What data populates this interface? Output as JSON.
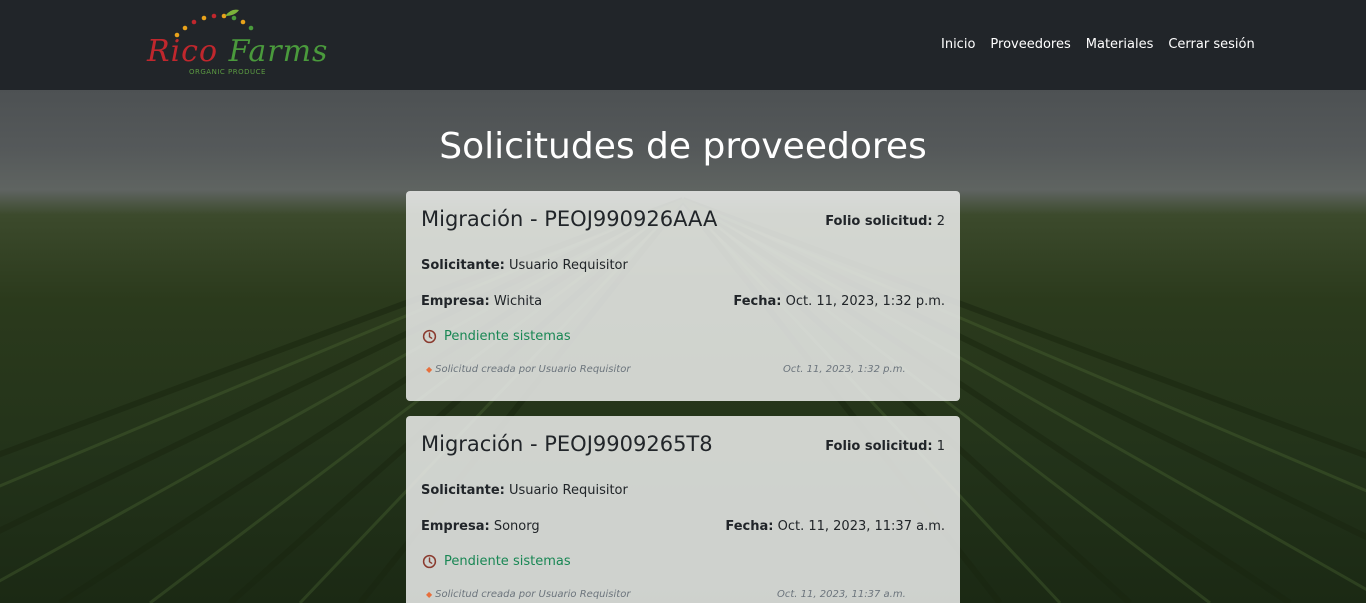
{
  "brand": {
    "name_part1": "Rico",
    "name_part2": "Farms",
    "tagline": "ORGANIC PRODUCE"
  },
  "nav": {
    "items": [
      {
        "label": "Inicio"
      },
      {
        "label": "Proveedores"
      },
      {
        "label": "Materiales"
      },
      {
        "label": "Cerrar sesión"
      }
    ]
  },
  "page": {
    "title": "Solicitudes de proveedores"
  },
  "requests": [
    {
      "title": "Migración - PEOJ990926AAA",
      "folio_label": "Folio solicitud:",
      "folio": "2",
      "requester_label": "Solicitante:",
      "requester": "Usuario Requisitor",
      "company_label": "Empresa:",
      "company": "Wichita",
      "date_label": "Fecha:",
      "date": "Oct. 11, 2023, 1:32 p.m.",
      "status": "Pendiente sistemas",
      "log_text": "Solicitud creada por Usuario Requisitor",
      "log_date": "Oct. 11, 2023, 1:32 p.m."
    },
    {
      "title": "Migración - PEOJ9909265T8",
      "folio_label": "Folio solicitud:",
      "folio": "1",
      "requester_label": "Solicitante:",
      "requester": "Usuario Requisitor",
      "company_label": "Empresa:",
      "company": "Sonorg",
      "date_label": "Fecha:",
      "date": "Oct. 11, 2023, 11:37 a.m.",
      "status": "Pendiente sistemas",
      "log_text": "Solicitud creada por Usuario Requisitor",
      "log_date": "Oct. 11, 2023, 11:37 a.m."
    }
  ],
  "colors": {
    "navbar": "#212529",
    "status_green": "#198754",
    "brand_red": "#c0272d",
    "brand_green": "#4a9a3c"
  }
}
